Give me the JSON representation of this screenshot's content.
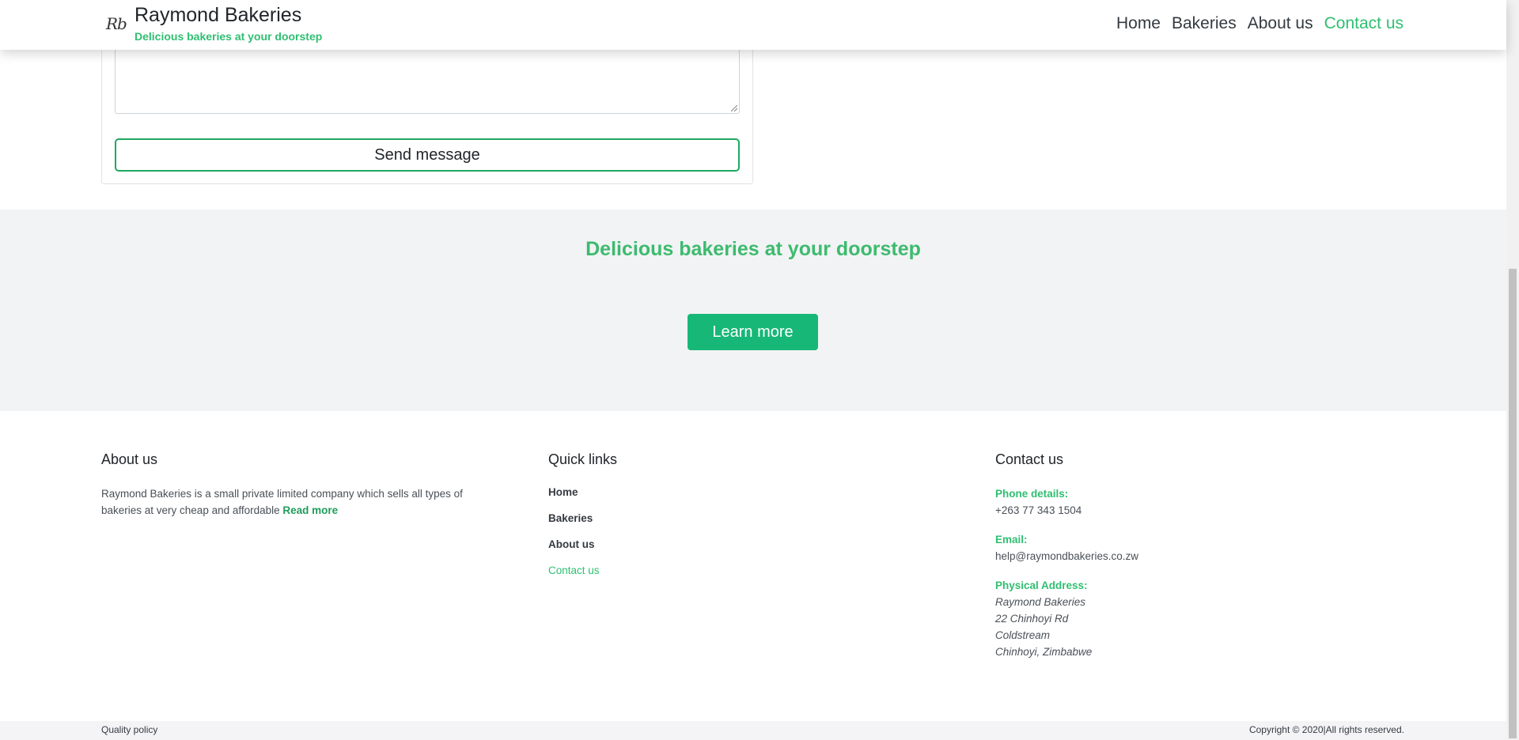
{
  "header": {
    "logo_text": "Rb",
    "title": "Raymond Bakeries",
    "subtitle": "Delicious bakeries at your doorstep",
    "nav": [
      {
        "label": "Home"
      },
      {
        "label": "Bakeries"
      },
      {
        "label": "About us"
      },
      {
        "label": "Contact us",
        "active": true
      }
    ]
  },
  "form": {
    "message_value": "",
    "send_label": "Send message"
  },
  "banner": {
    "title": "Delicious bakeries at your doorstep",
    "button_label": "Learn more"
  },
  "footer": {
    "about": {
      "heading": "About us",
      "text": "Raymond Bakeries is a small private limited company which sells all types of bakeries at very cheap and affordable",
      "read_more": "Read more"
    },
    "quick_links": {
      "heading": "Quick links",
      "links": [
        {
          "label": "Home"
        },
        {
          "label": "Bakeries"
        },
        {
          "label": "About us"
        },
        {
          "label": "Contact us",
          "active": true
        }
      ]
    },
    "contact": {
      "heading": "Contact us",
      "phone_label": "Phone details:",
      "phone": "+263 77 343 1504",
      "email_label": "Email:",
      "email": "help@raymondbakeries.co.zw",
      "address_label": "Physical Address:",
      "address_lines": [
        "Raymond Bakeries",
        "22 Chinhoyi Rd",
        "Coldstream",
        "Chinhoyi, Zimbabwe"
      ]
    }
  },
  "bottom": {
    "quality_policy": "Quality policy",
    "copyright": "Copyright © 2020|All rights reserved."
  },
  "colors": {
    "accent": "#2fbf71",
    "button": "#17b877",
    "banner_bg": "#f2f3f5"
  }
}
